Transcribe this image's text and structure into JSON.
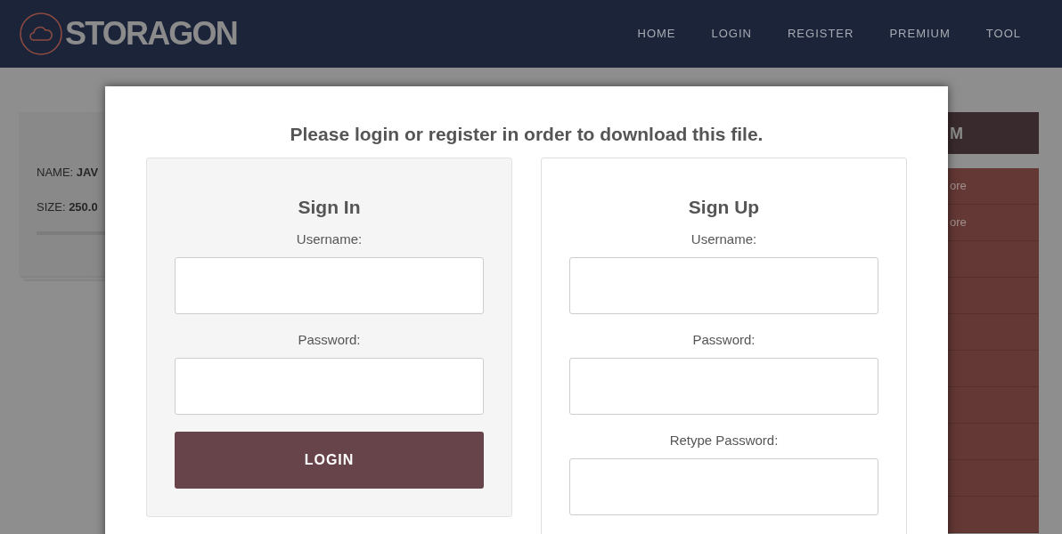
{
  "header": {
    "logo": "STORAGON",
    "nav": [
      "HOME",
      "LOGIN",
      "REGISTER",
      "PREMIUM",
      "TOOL"
    ]
  },
  "file_card": {
    "rows": [
      "NAME: **JAV**",
      "SIZE: **250.0**"
    ]
  },
  "sidebar": {
    "title": "M",
    "items": [
      "ore",
      "ore"
    ]
  },
  "modal": {
    "title": "Please login or register in order to download this file.",
    "sign_in": {
      "heading": "Sign In",
      "fields": [
        {
          "label": "Username:"
        },
        {
          "label": "Password:"
        }
      ],
      "button": "LOGIN"
    },
    "sign_up": {
      "heading": "Sign Up",
      "fields": [
        {
          "label": "Username:"
        },
        {
          "label": "Password:"
        },
        {
          "label": "Retype Password:"
        }
      ]
    }
  }
}
